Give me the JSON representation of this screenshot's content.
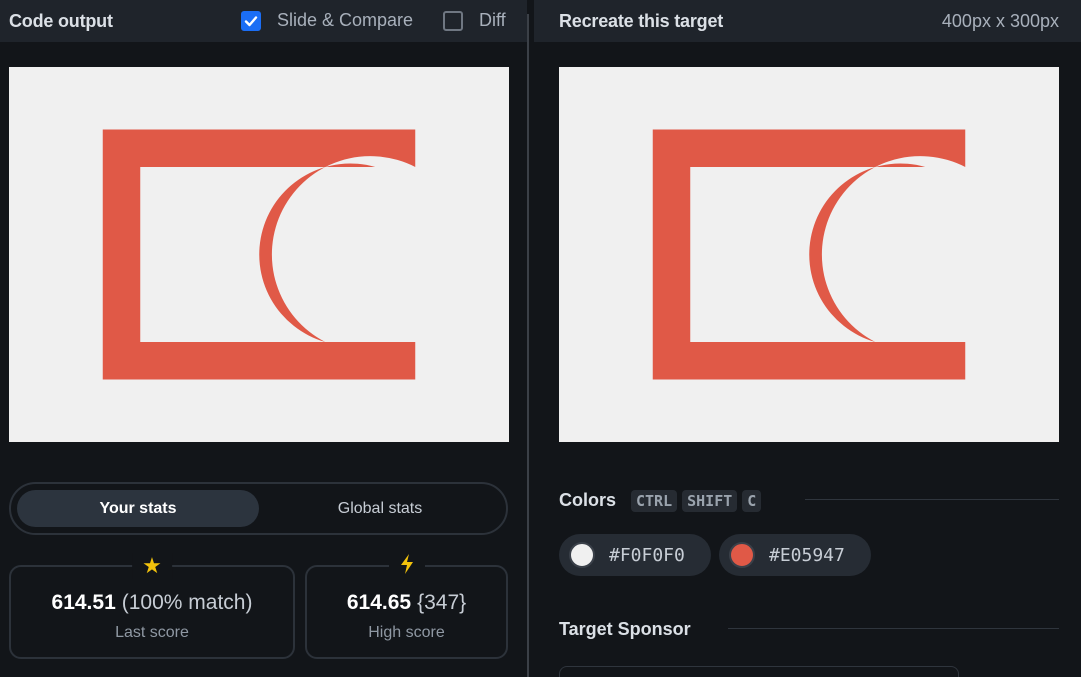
{
  "left_panel": {
    "title": "Code output",
    "slide_compare": {
      "label": "Slide & Compare",
      "checked": true
    },
    "diff": {
      "label": "Diff",
      "checked": false
    }
  },
  "right_panel": {
    "title": "Recreate this target",
    "size": "400px x 300px"
  },
  "stats_toggle": {
    "your_stats": "Your stats",
    "global_stats": "Global stats"
  },
  "last_score": {
    "value": "614.51",
    "match": "(100% match)",
    "label": "Last score",
    "icon": "star-icon"
  },
  "high_score": {
    "value": "614.65",
    "count": "{347}",
    "label": "High score",
    "icon": "lightning-icon"
  },
  "colors": {
    "title": "Colors",
    "shortcut": [
      "CTRL",
      "SHIFT",
      "C"
    ],
    "swatches": [
      {
        "hex": "#F0F0F0",
        "color": "#f0f0f0"
      },
      {
        "hex": "#E05947",
        "color": "#e05947"
      }
    ]
  },
  "sponsor": {
    "title": "Target Sponsor"
  },
  "palette": {
    "background": "#f0f0f0",
    "shape": "#e05947",
    "accent": "#1b6ef5"
  }
}
